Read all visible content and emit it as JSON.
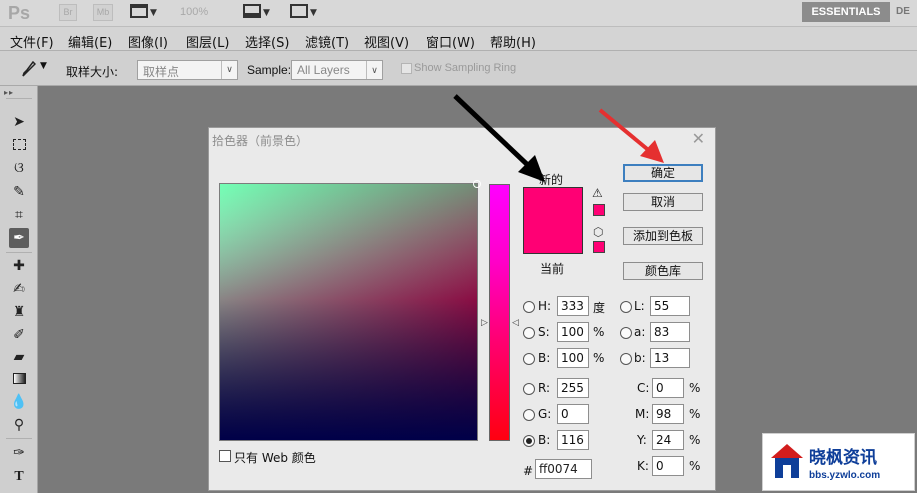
{
  "app": {
    "logo": "Ps",
    "bridge_label": "Br",
    "minibridge_label": "Mb",
    "zoom": "100%",
    "workspace": "ESSENTIALS",
    "workspace_next": "DE"
  },
  "menu": {
    "items": [
      "文件(F)",
      "编辑(E)",
      "图像(I)",
      "图层(L)",
      "选择(S)",
      "滤镜(T)",
      "视图(V)",
      "窗口(W)",
      "帮助(H)"
    ]
  },
  "options": {
    "sample_size_label": "取样大小:",
    "sample_size_value": "取样点",
    "sample_label": "Sample:",
    "sample_value": "All Layers",
    "show_ring_label": "Show Sampling Ring"
  },
  "tools": {
    "icons": [
      "move-icon",
      "marquee-icon",
      "lasso-icon",
      "quick-select-icon",
      "crop-icon",
      "eyedropper-icon",
      "spot-heal-icon",
      "brush-icon",
      "clone-stamp-icon",
      "history-brush-icon",
      "eraser-icon",
      "gradient-icon",
      "blur-icon",
      "dodge-icon",
      "pen-icon",
      "type-icon"
    ]
  },
  "dialog": {
    "title": "拾色器（前景色）",
    "new_label": "新的",
    "current_label": "当前",
    "color_hex": "#ff0074",
    "buttons": {
      "ok": "确定",
      "cancel": "取消",
      "add_to_swatches": "添加到色板",
      "color_libraries": "颜色库"
    },
    "hsb": {
      "h_label": "H:",
      "h_value": "333",
      "h_unit": "度",
      "s_label": "S:",
      "s_value": "100",
      "s_unit": "%",
      "b_label": "B:",
      "b_value": "100",
      "b_unit": "%"
    },
    "rgb": {
      "r_label": "R:",
      "r_value": "255",
      "g_label": "G:",
      "g_value": "0",
      "b_label": "B:",
      "b_value": "116"
    },
    "lab": {
      "l_label": "L:",
      "l_value": "55",
      "a_label": "a:",
      "a_value": "83",
      "b_label": "b:",
      "b_value": "13"
    },
    "cmyk": {
      "c_label": "C:",
      "c_value": "0",
      "c_unit": "%",
      "m_label": "M:",
      "m_value": "98",
      "m_unit": "%",
      "y_label": "Y:",
      "y_value": "24",
      "y_unit": "%",
      "k_label": "K:",
      "k_value": "0",
      "k_unit": "%"
    },
    "web_only_label": "只有 Web 颜色",
    "hash_label": "#",
    "hex_value": "ff0074",
    "selected_mode": "B (RGB)"
  },
  "watermark": {
    "text": "晓枫资讯",
    "url": "bbs.yzwlo.com"
  }
}
